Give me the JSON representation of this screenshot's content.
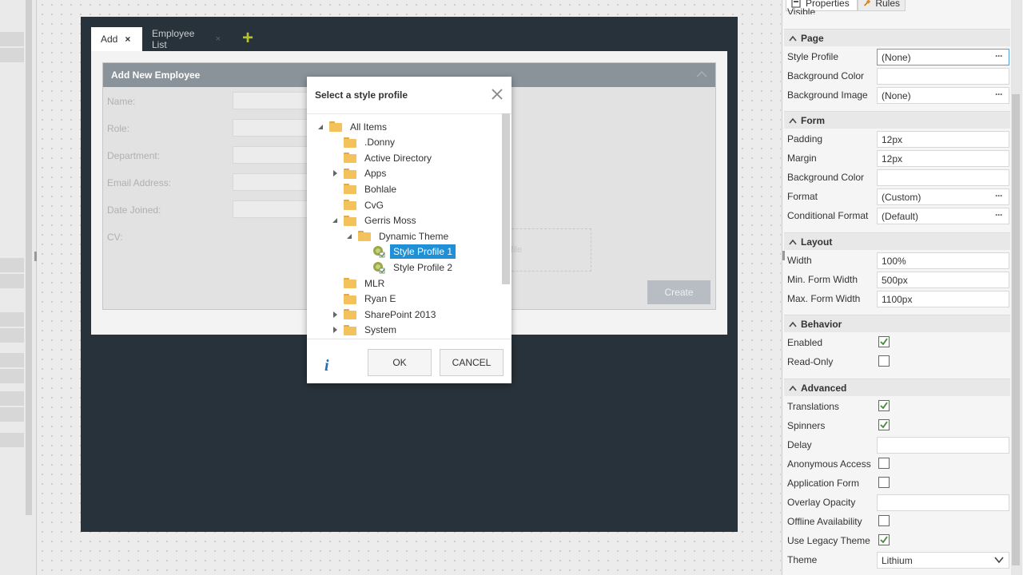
{
  "left_bars": [
    40,
    60,
    323,
    343,
    391,
    411,
    442,
    462,
    490,
    510,
    542
  ],
  "form_tabs": {
    "add_label": "Add",
    "add_close": "×",
    "list_label": "Employee List",
    "list_close": "×",
    "plus": "+"
  },
  "form": {
    "title": "Add New Employee",
    "fields": [
      "Name:",
      "Role:",
      "Department:",
      "Email Address:",
      "Date Joined:",
      "CV:"
    ],
    "dropzone_text": "file",
    "create_label": "Create"
  },
  "dialog": {
    "title": "Select a style profile",
    "tree": [
      {
        "label": "All Items",
        "level": 0,
        "toggle": "expanded",
        "icon": "folder-icon"
      },
      {
        "label": ".Donny",
        "level": 1,
        "toggle": "none",
        "icon": "folder-icon"
      },
      {
        "label": "Active Directory",
        "level": 1,
        "toggle": "none",
        "icon": "folder-icon"
      },
      {
        "label": "Apps",
        "level": 1,
        "toggle": "collapsed",
        "icon": "folder-icon"
      },
      {
        "label": "Bohlale",
        "level": 1,
        "toggle": "none",
        "icon": "folder-icon"
      },
      {
        "label": "CvG",
        "level": 1,
        "toggle": "none",
        "icon": "folder-icon"
      },
      {
        "label": "Gerris Moss",
        "level": 1,
        "toggle": "expanded",
        "icon": "folder-icon"
      },
      {
        "label": "Dynamic Theme",
        "level": 2,
        "toggle": "expanded",
        "icon": "folder-icon"
      },
      {
        "label": "Style Profile 1",
        "level": 3,
        "toggle": "none",
        "icon": "style-profile-icon",
        "selected": true
      },
      {
        "label": "Style Profile 2",
        "level": 3,
        "toggle": "none",
        "icon": "style-profile-icon"
      },
      {
        "label": "MLR",
        "level": 1,
        "toggle": "none",
        "icon": "folder-icon"
      },
      {
        "label": "Ryan E",
        "level": 1,
        "toggle": "none",
        "icon": "folder-icon"
      },
      {
        "label": "SharePoint 2013",
        "level": 1,
        "toggle": "collapsed",
        "icon": "folder-icon"
      },
      {
        "label": "System",
        "level": 1,
        "toggle": "collapsed",
        "icon": "folder-icon"
      }
    ],
    "info": "i",
    "ok_label": "OK",
    "cancel_label": "CANCEL"
  },
  "props": {
    "tabs": {
      "properties": "Properties",
      "rules": "Rules"
    },
    "top_partial": "Visible",
    "sections": [
      {
        "title": "Page",
        "rows": [
          {
            "label": "Style Profile",
            "type": "text",
            "value": "(None)",
            "dots": true,
            "active": true
          },
          {
            "label": "Background Color",
            "type": "text",
            "value": ""
          },
          {
            "label": "Background Image",
            "type": "text",
            "value": "(None)",
            "dots": true
          }
        ]
      },
      {
        "title": "Form",
        "rows": [
          {
            "label": "Padding",
            "type": "text",
            "value": "12px"
          },
          {
            "label": "Margin",
            "type": "text",
            "value": "12px"
          },
          {
            "label": "Background Color",
            "type": "text",
            "value": ""
          },
          {
            "label": "Format",
            "type": "text",
            "value": "(Custom)",
            "dots": true
          },
          {
            "label": "Conditional Format",
            "type": "text",
            "value": "(Default)",
            "dots": true
          }
        ]
      },
      {
        "title": "Layout",
        "rows": [
          {
            "label": "Width",
            "type": "text",
            "value": "100%"
          },
          {
            "label": "Min. Form Width",
            "type": "text",
            "value": "500px"
          },
          {
            "label": "Max. Form Width",
            "type": "text",
            "value": "1100px"
          }
        ]
      },
      {
        "title": "Behavior",
        "rows": [
          {
            "label": "Enabled",
            "type": "check",
            "checked": true
          },
          {
            "label": "Read-Only",
            "type": "check",
            "checked": false
          }
        ]
      },
      {
        "title": "Advanced",
        "rows": [
          {
            "label": "Translations",
            "type": "check",
            "checked": true
          },
          {
            "label": "Spinners",
            "type": "check",
            "checked": true
          },
          {
            "label": "Delay",
            "type": "text",
            "value": ""
          },
          {
            "label": "Anonymous Access",
            "type": "check",
            "checked": false
          },
          {
            "label": "Application Form",
            "type": "check",
            "checked": false
          },
          {
            "label": "Overlay Opacity",
            "type": "text",
            "value": ""
          },
          {
            "label": "Offline Availability",
            "type": "check",
            "checked": false
          },
          {
            "label": "Use Legacy Theme",
            "type": "check",
            "checked": true
          },
          {
            "label": "Theme",
            "type": "select",
            "value": "Lithium"
          }
        ]
      }
    ]
  },
  "colors": {
    "accent_blue": "#1f8fd6",
    "folder_yellow": "#f4c25d",
    "check_green": "#3b8f2e",
    "dark_frame": "#28323a",
    "plus_green": "#b4c52a"
  }
}
